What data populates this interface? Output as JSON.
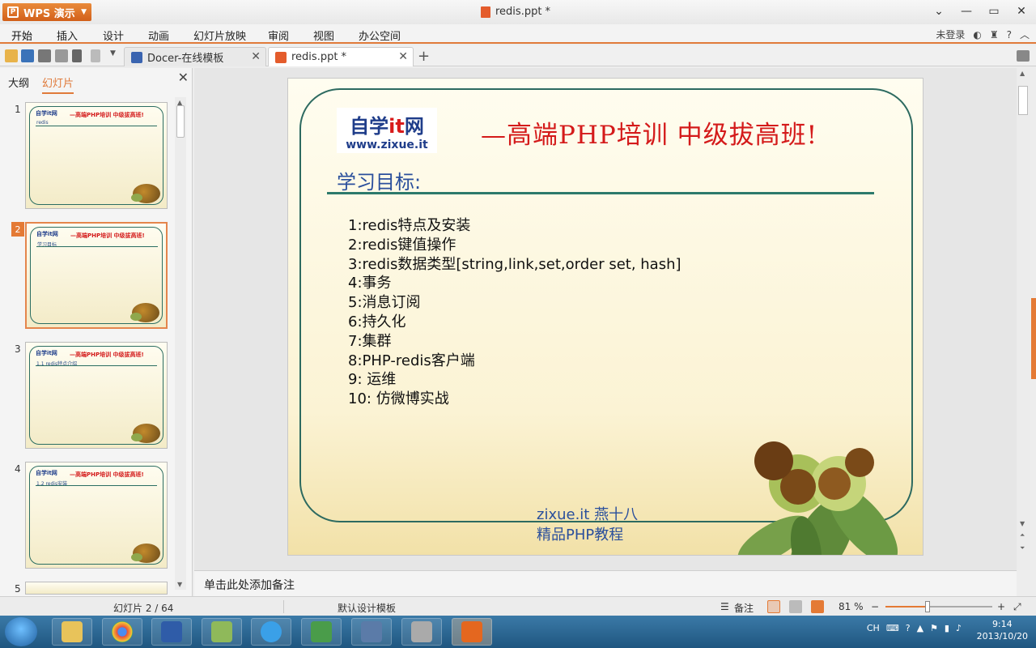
{
  "window": {
    "app_name": "WPS 演示",
    "doc_title": "redis.ppt *"
  },
  "menu": {
    "items": [
      "开始",
      "插入",
      "设计",
      "动画",
      "幻灯片放映",
      "审阅",
      "视图",
      "办公空间"
    ],
    "login": "未登录"
  },
  "tabs": [
    {
      "label": "Docer-在线模板"
    },
    {
      "label": "redis.ppt *"
    }
  ],
  "left_panel": {
    "tab_outline": "大纲",
    "tab_slides": "幻灯片",
    "thumbnails": [
      {
        "num": "1",
        "subtitle": "redis"
      },
      {
        "num": "2",
        "subtitle": "学习目标"
      },
      {
        "num": "3",
        "subtitle": "1.1 redis特点介绍"
      },
      {
        "num": "4",
        "subtitle": "1.2 redis安装"
      },
      {
        "num": "5",
        "subtitle": ""
      }
    ],
    "selected_badge": "2"
  },
  "slide": {
    "logo_main_a": "自学",
    "logo_main_b": "it",
    "logo_main_c": "网",
    "logo_url": "www.zixue.it",
    "headline": "—高端PHP培训  中级拔高班!",
    "subtitle": "学习目标:",
    "list": [
      "1:redis特点及安装",
      "2:redis键值操作",
      "3:redis数据类型[string,link,set,order set, hash]",
      "4:事务",
      "5:消息订阅",
      "6:持久化",
      "7:集群",
      "8:PHP-redis客户端",
      "9: 运维",
      "10: 仿微博实战"
    ],
    "footer_line1": "zixue.it 燕十八",
    "footer_line2": "精品PHP教程"
  },
  "notes": {
    "placeholder": "单击此处添加备注"
  },
  "status": {
    "slide_pos": "幻灯片 2 / 64",
    "template": "默认设计模板",
    "notes_btn": "备注",
    "zoom": "81 %",
    "zoom_level": 0.81
  },
  "taskbar": {
    "lang": "CH",
    "time": "9:14",
    "date": "2013/10/20"
  },
  "colors": {
    "accent": "#e47a35",
    "headline_red": "#d41a1a",
    "frame_green": "#2d6a60",
    "subtitle_blue": "#2a4f9c"
  }
}
